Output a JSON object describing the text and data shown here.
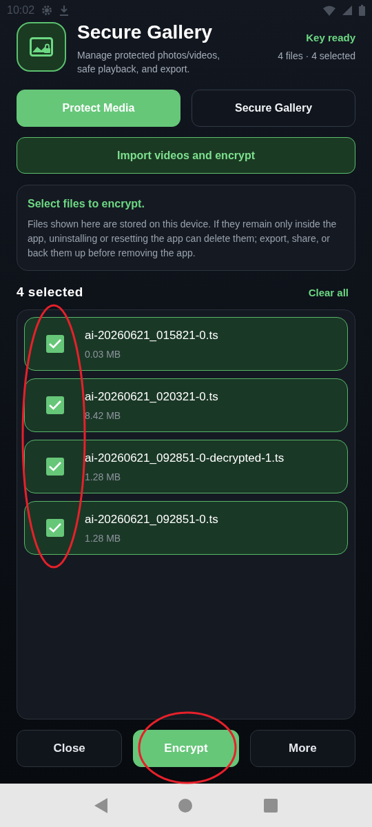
{
  "status_bar": {
    "time": "10:02"
  },
  "header": {
    "title": "Secure Gallery",
    "subtitle": "Manage protected photos/videos, safe playback, and export.",
    "key_status": "Key ready",
    "counts": "4 files · 4 selected"
  },
  "tabs": [
    {
      "label": "Protect Media",
      "selected": true
    },
    {
      "label": "Secure Gallery",
      "selected": false
    }
  ],
  "import_button": "Import videos and encrypt",
  "info_card": {
    "title": "Select files to encrypt.",
    "body": "Files shown here are stored on this device. If they remain only inside the app, uninstalling or resetting the app can delete them; export, share, or back them up before removing the app."
  },
  "selection": {
    "count": "4 selected",
    "clear": "Clear all"
  },
  "files": [
    {
      "name": "ai-20260621_015821-0.ts",
      "size": "0.03 MB",
      "checked": true
    },
    {
      "name": "ai-20260621_020321-0.ts",
      "size": "8.42 MB",
      "checked": true
    },
    {
      "name": "ai-20260621_092851-0-decrypted-1.ts",
      "size": "1.28 MB",
      "checked": true
    },
    {
      "name": "ai-20260621_092851-0.ts",
      "size": "1.28 MB",
      "checked": true
    }
  ],
  "actions": [
    {
      "label": "Close",
      "kind": "secondary"
    },
    {
      "label": "Encrypt",
      "kind": "primary"
    },
    {
      "label": "More",
      "kind": "secondary"
    }
  ]
}
